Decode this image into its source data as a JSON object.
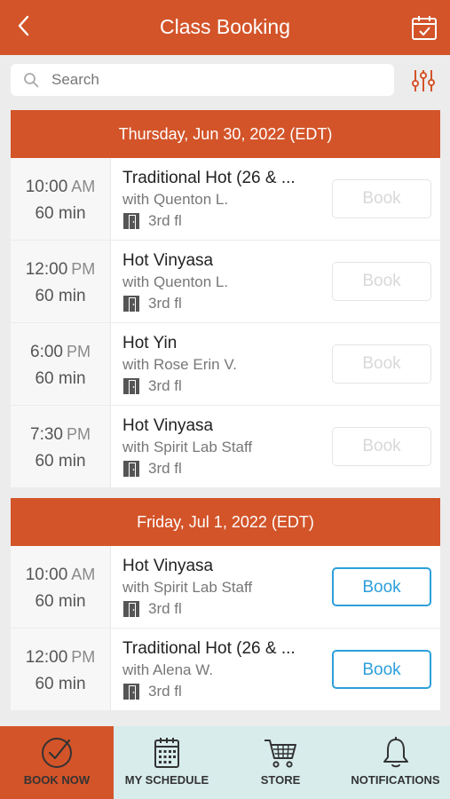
{
  "header": {
    "title": "Class Booking",
    "back_icon": "chevron-left-icon",
    "calendar_icon": "calendar-check-icon"
  },
  "search": {
    "placeholder": "Search",
    "value": ""
  },
  "colors": {
    "brand": "#d35429",
    "accent_blue": "#2c9fdb",
    "nav_bg": "#d8ecec"
  },
  "days": [
    {
      "label": "Thursday, Jun 30, 2022 (EDT)",
      "classes": [
        {
          "time": "10:00",
          "ampm": "AM",
          "duration": "60 min",
          "name": "Traditional Hot (26 & ...",
          "instructor": "with Quenton L.",
          "room": "3rd fl",
          "book_label": "Book",
          "bookable": false
        },
        {
          "time": "12:00",
          "ampm": "PM",
          "duration": "60 min",
          "name": "Hot Vinyasa",
          "instructor": "with Quenton L.",
          "room": "3rd fl",
          "book_label": "Book",
          "bookable": false
        },
        {
          "time": "6:00",
          "ampm": "PM",
          "duration": "60 min",
          "name": "Hot Yin",
          "instructor": "with Rose Erin V.",
          "room": "3rd fl",
          "book_label": "Book",
          "bookable": false
        },
        {
          "time": "7:30",
          "ampm": "PM",
          "duration": "60 min",
          "name": "Hot Vinyasa",
          "instructor": "with Spirit Lab Staff",
          "room": "3rd fl",
          "book_label": "Book",
          "bookable": false
        }
      ]
    },
    {
      "label": "Friday, Jul 1, 2022 (EDT)",
      "classes": [
        {
          "time": "10:00",
          "ampm": "AM",
          "duration": "60 min",
          "name": "Hot Vinyasa",
          "instructor": "with Spirit Lab Staff",
          "room": "3rd fl",
          "book_label": "Book",
          "bookable": true
        },
        {
          "time": "12:00",
          "ampm": "PM",
          "duration": "60 min",
          "name": "Traditional Hot (26 & ...",
          "instructor": "with Alena W.",
          "room": "3rd fl",
          "book_label": "Book",
          "bookable": true
        }
      ]
    }
  ],
  "nav": [
    {
      "label": "BOOK NOW",
      "icon": "check-circle-icon",
      "active": true
    },
    {
      "label": "MY SCHEDULE",
      "icon": "calendar-grid-icon",
      "active": false
    },
    {
      "label": "STORE",
      "icon": "cart-icon",
      "active": false
    },
    {
      "label": "NOTIFICATIONS",
      "icon": "bell-icon",
      "active": false
    }
  ]
}
